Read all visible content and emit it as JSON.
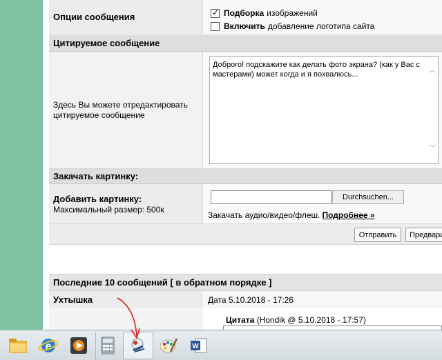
{
  "options": {
    "label": "Опции сообщения",
    "opt1_bold": "Подборка",
    "opt1_rest": "изображений",
    "opt1_checked": true,
    "opt2_bold": "Включить",
    "opt2_rest": "добавление логотипа сайта",
    "opt2_checked": false
  },
  "quote": {
    "header": "Цитируемое сообщение",
    "label": "Здесь Вы можете отредактировать цитируемое сообщение",
    "text": "Доброго! подскажите как делать фото экрана? (как у Вас с мастерами) может когда и я похвалюсь..."
  },
  "upload": {
    "header": "Закачать картинку:",
    "add_label": "Добавить картинку:",
    "max_size": "Максимальный размер: 500к",
    "browse_label": "Durchsuchen...",
    "media_text": "Закачать аудио/видео/флеш.",
    "media_link": "Подробнее »"
  },
  "buttons": {
    "send": "Отправить",
    "preview": "Предвари"
  },
  "last_posts": {
    "header": "Последние 10 сообщений [ в обратном порядке ]",
    "author": "Ухтышка",
    "date": "Дата 5.10.2018 - 17:26",
    "quote_label": "Цитата",
    "quote_meta": "(Hondik @ 5.10.2018 - 17:57)"
  },
  "taskbar": {
    "icons": [
      "file-explorer-icon",
      "internet-explorer-icon",
      "media-player-icon",
      "calculator-icon",
      "snipping-tool-icon",
      "paint-icon",
      "word-icon"
    ]
  },
  "colors": {
    "green_strip": "#7fc3a2",
    "annotation_arrow": "#e0201c"
  }
}
